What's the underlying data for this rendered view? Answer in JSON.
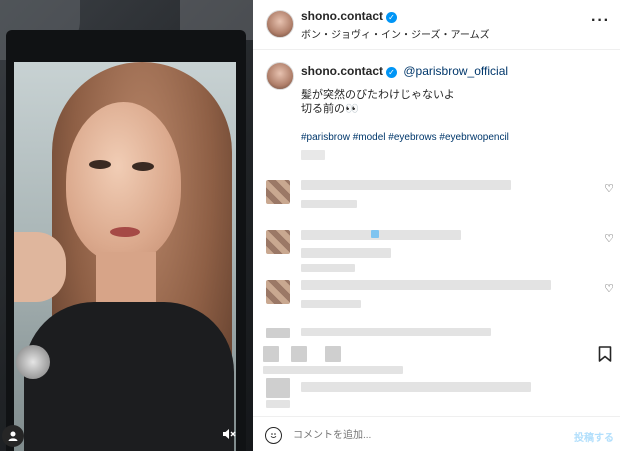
{
  "post": {
    "username": "shono.contact",
    "location": "ボン・ジョヴィ・イン・ジーズ・アームズ",
    "caption_username": "shono.contact",
    "mention": "@parisbrow_official",
    "caption_line1": "髪が突然のびたわけじゃないよ",
    "caption_line2": "切る前の👀",
    "hashtags": "#parisbrow #model #eyebrows #eyebrwopencil"
  },
  "icons": {
    "verified": "verified-badge-icon",
    "more": "more-options-icon",
    "heart": "heart-icon",
    "bookmark": "bookmark-icon",
    "emoji": "emoji-icon",
    "user": "user-tag-icon",
    "mute": "muted-speaker-icon"
  },
  "footer": {
    "comment_placeholder": "コメントを追加...",
    "post_label": "投稿する"
  },
  "colors": {
    "link": "#00376b",
    "verified": "#0095f6",
    "post_disabled": "#b2dffc"
  }
}
